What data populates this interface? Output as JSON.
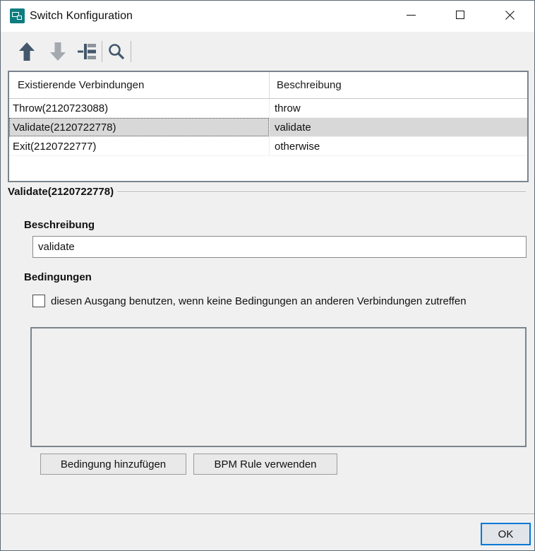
{
  "window": {
    "title": "Switch Konfiguration"
  },
  "toolbar": {
    "icons": [
      {
        "name": "move-up-icon",
        "enabled": true
      },
      {
        "name": "move-down-icon",
        "enabled": false
      },
      {
        "name": "tree-connections-icon",
        "enabled": true
      },
      {
        "name": "search-icon",
        "enabled": true
      }
    ]
  },
  "table": {
    "columns": {
      "connection": "Existierende Verbindungen",
      "description": "Beschreibung"
    },
    "rows": [
      {
        "connection": "Throw(2120723088)",
        "description": "throw",
        "selected": false
      },
      {
        "connection": "Validate(2120722778)",
        "description": "validate",
        "selected": true
      },
      {
        "connection": "Exit(2120722777)",
        "description": "otherwise",
        "selected": false
      }
    ]
  },
  "details": {
    "group_title": "Validate(2120722778)",
    "beschreibung_label": "Beschreibung",
    "beschreibung_value": "validate",
    "bedingungen_label": "Bedingungen",
    "checkbox_label": "diesen Ausgang benutzen, wenn keine Bedingungen an anderen Verbindungen zutreffen",
    "checkbox_checked": false,
    "buttons": {
      "add_condition": "Bedingung hinzufügen",
      "use_bpm_rule": "BPM Rule verwenden"
    }
  },
  "footer": {
    "ok_label": "OK"
  },
  "colors": {
    "accent_blue": "#0078d7",
    "titlebar_icon_teal": "#0e7d80",
    "toolbar_icon_slate": "#44576b",
    "selection_gray": "#d8d8d8",
    "panel_border": "#7b848d"
  }
}
